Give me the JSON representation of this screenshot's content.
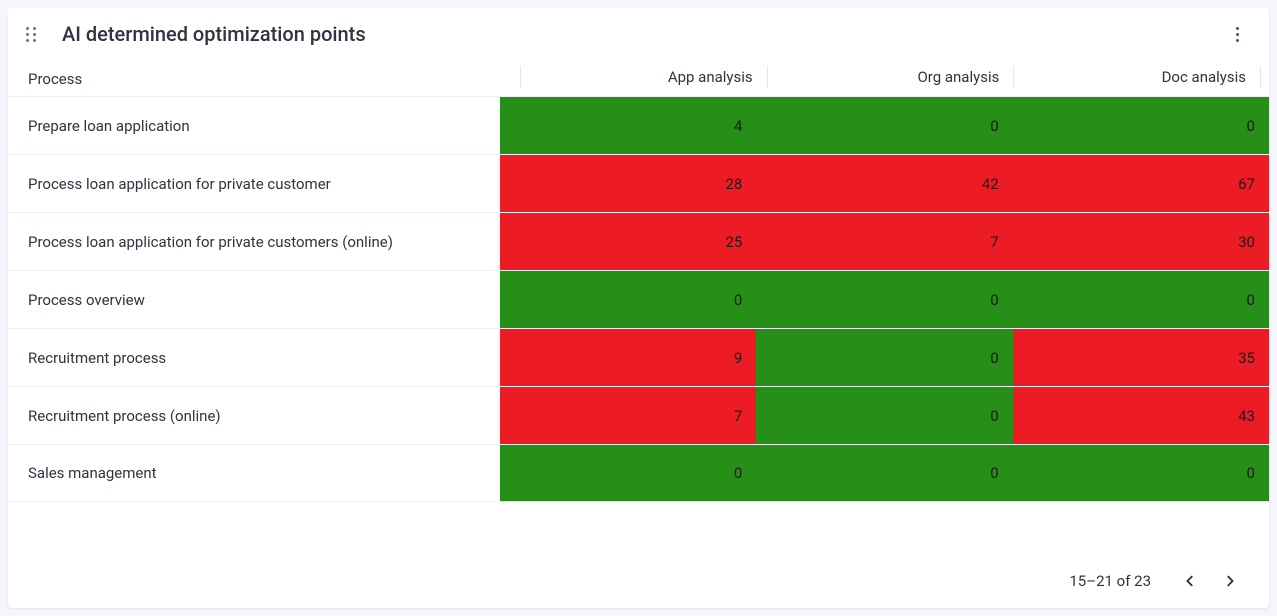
{
  "card": {
    "title": "AI determined optimization points"
  },
  "columns": {
    "process": "Process",
    "app": "App analysis",
    "org": "Org analysis",
    "doc": "Doc analysis"
  },
  "rows": [
    {
      "process": "Prepare loan application",
      "app": {
        "v": "4",
        "c": "green"
      },
      "org": {
        "v": "0",
        "c": "green"
      },
      "doc": {
        "v": "0",
        "c": "green"
      }
    },
    {
      "process": "Process loan application for private customer",
      "app": {
        "v": "28",
        "c": "red"
      },
      "org": {
        "v": "42",
        "c": "red"
      },
      "doc": {
        "v": "67",
        "c": "red"
      }
    },
    {
      "process": "Process loan application for private customers (online)",
      "app": {
        "v": "25",
        "c": "red"
      },
      "org": {
        "v": "7",
        "c": "red"
      },
      "doc": {
        "v": "30",
        "c": "red"
      }
    },
    {
      "process": "Process overview",
      "app": {
        "v": "0",
        "c": "green"
      },
      "org": {
        "v": "0",
        "c": "green"
      },
      "doc": {
        "v": "0",
        "c": "green"
      }
    },
    {
      "process": "Recruitment process",
      "app": {
        "v": "9",
        "c": "red"
      },
      "org": {
        "v": "0",
        "c": "green"
      },
      "doc": {
        "v": "35",
        "c": "red"
      }
    },
    {
      "process": "Recruitment process (online)",
      "app": {
        "v": "7",
        "c": "red"
      },
      "org": {
        "v": "0",
        "c": "green"
      },
      "doc": {
        "v": "43",
        "c": "red"
      }
    },
    {
      "process": "Sales management",
      "app": {
        "v": "0",
        "c": "green"
      },
      "org": {
        "v": "0",
        "c": "green"
      },
      "doc": {
        "v": "0",
        "c": "green"
      }
    }
  ],
  "footer": {
    "range": "15–21 of 23"
  },
  "chart_data": {
    "type": "heatmap",
    "title": "AI determined optimization points",
    "columns": [
      "App analysis",
      "Org analysis",
      "Doc analysis"
    ],
    "categories": [
      "Prepare loan application",
      "Process loan application for private customer",
      "Process loan application for private customers (online)",
      "Process overview",
      "Recruitment process",
      "Recruitment process (online)",
      "Sales management"
    ],
    "values": [
      [
        4,
        0,
        0
      ],
      [
        28,
        42,
        67
      ],
      [
        25,
        7,
        30
      ],
      [
        0,
        0,
        0
      ],
      [
        9,
        0,
        35
      ],
      [
        7,
        0,
        43
      ],
      [
        0,
        0,
        0
      ]
    ],
    "color_scale": {
      "low": "#268f17",
      "high": "#ed1c24"
    }
  }
}
